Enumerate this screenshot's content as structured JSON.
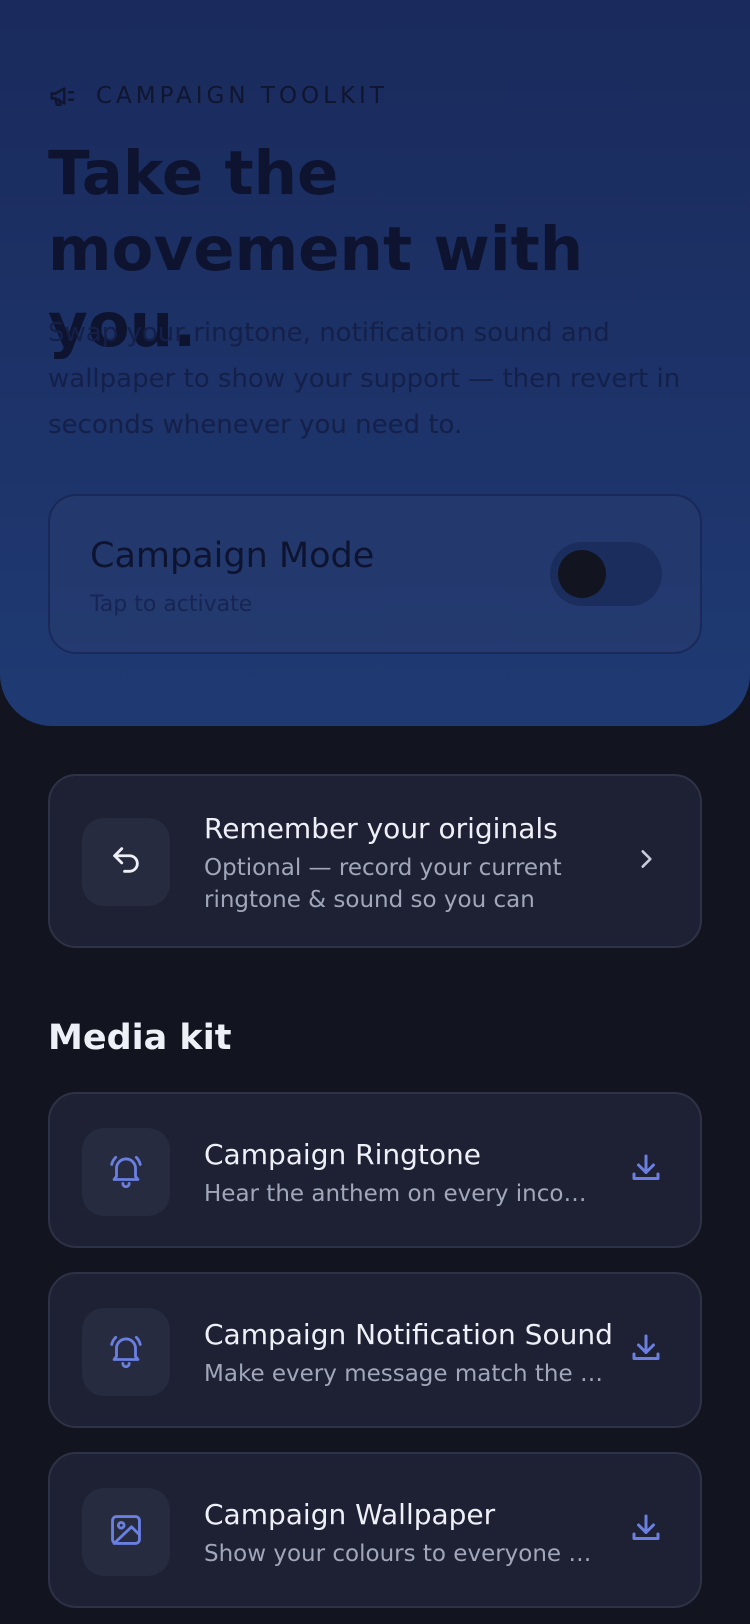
{
  "hero": {
    "eyebrow": "CAMPAIGN TOOLKIT",
    "eyebrow_icon": "megaphone-icon",
    "title": "Take the movement with you.",
    "description": "Swap your ringtone, notification sound and wallpaper to show your support — then revert in seconds whenever you need to."
  },
  "campaign_mode": {
    "title": "Campaign Mode",
    "subtitle": "Tap to activate",
    "enabled": false
  },
  "originals": {
    "icon": "undo-arrow-icon",
    "title": "Remember your originals",
    "subtitle": "Optional — record your current ringtone & sound so you can reve…",
    "action_icon": "chevron-right-icon"
  },
  "media_kit": {
    "title": "Media kit",
    "items": [
      {
        "icon": "bell-icon",
        "title": "Campaign Ringtone",
        "subtitle": "Hear the anthem on every incoming call.",
        "action_icon": "download-icon"
      },
      {
        "icon": "bell-icon",
        "title": "Campaign Notification Sound",
        "subtitle": "Make every message match the campaign.",
        "action_icon": "download-icon"
      },
      {
        "icon": "image-icon",
        "title": "Campaign Wallpaper",
        "subtitle": "Show your colours to everyone nearby.",
        "action_icon": "download-icon"
      }
    ]
  },
  "colors": {
    "background": "#12141f",
    "hero_top": "#1a2a5c",
    "hero_bottom": "#1f3a73",
    "card": "#1e2133",
    "accent_icon": "#6a7fe0"
  }
}
